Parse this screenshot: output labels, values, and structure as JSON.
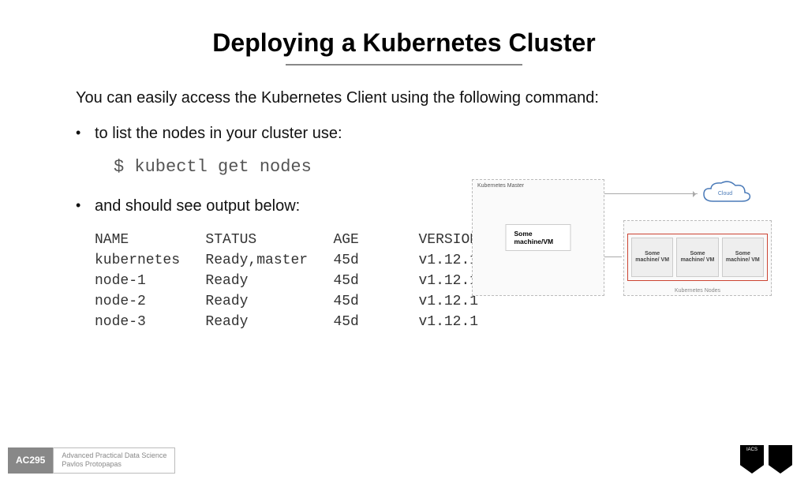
{
  "title": "Deploying a Kubernetes Cluster",
  "intro": "You can easily access the Kubernetes Client using the following command:",
  "bullet1": "to list the nodes in your cluster use:",
  "command": "$ kubectl get nodes",
  "bullet2": "and should see output below:",
  "output_header": "NAME         STATUS         AGE       VERSION",
  "output_rows": [
    "kubernetes   Ready,master   45d       v1.12.1",
    "node-1       Ready          45d       v1.12.1",
    "node-2       Ready          45d       v1.12.1",
    "node-3       Ready          45d       v1.12.1"
  ],
  "diagram": {
    "master_label": "Kubernetes Master",
    "master_center": "Some machine/VM",
    "cloud_label": "Cloud",
    "node_label": "Some machine/ VM",
    "nodes_label": "Kubernetes Nodes"
  },
  "footer": {
    "code": "AC295",
    "line1": "Advanced Practical Data Science",
    "line2": "Pavlos Protopapas",
    "logo1": "IACS"
  },
  "chart_data": {
    "type": "table",
    "columns": [
      "NAME",
      "STATUS",
      "AGE",
      "VERSION"
    ],
    "rows": [
      [
        "kubernetes",
        "Ready,master",
        "45d",
        "v1.12.1"
      ],
      [
        "node-1",
        "Ready",
        "45d",
        "v1.12.1"
      ],
      [
        "node-2",
        "Ready",
        "45d",
        "v1.12.1"
      ],
      [
        "node-3",
        "Ready",
        "45d",
        "v1.12.1"
      ]
    ]
  }
}
